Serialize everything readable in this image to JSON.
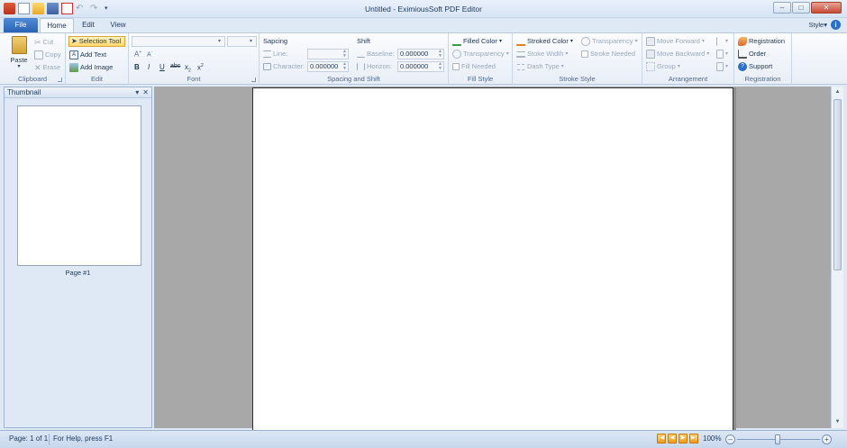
{
  "window": {
    "title": "Untitled - EximiousSoft PDF Editor"
  },
  "tabs": {
    "file": "File",
    "home": "Home",
    "edit": "Edit",
    "view": "View",
    "style_menu": "Style"
  },
  "ribbon": {
    "clipboard": {
      "label": "Clipboard",
      "paste": "Paste",
      "cut": "Cut",
      "copy": "Copy",
      "erase": "Erase"
    },
    "edit": {
      "label": "Edit",
      "selection_tool": "Selection Tool",
      "add_text": "Add Text",
      "add_image": "Add Image"
    },
    "font": {
      "label": "Font",
      "font_name": "",
      "font_size": ""
    },
    "spacing": {
      "label": "Spacing and Shift",
      "sapcing_title": "Sapcing",
      "line": "Line:",
      "character": "Character:",
      "character_value": "0.000000",
      "shift_title": "Shift",
      "baseline": "Baseline:",
      "baseline_value": "0.000000",
      "horizon": "Horizon:",
      "horizon_value": "0.000000"
    },
    "fill": {
      "label": "Fill Style",
      "filled_color": "Filled Color",
      "transparency": "Transparency",
      "fill_needed": "Fill Needed"
    },
    "stroke": {
      "label": "Stroke Style",
      "stroked_color": "Stroked Color",
      "stroke_width": "Stoke Width",
      "dash_type": "Dash Type",
      "transparency": "Transparency",
      "stroke_needed": "Stroke Needed"
    },
    "arrangement": {
      "label": "Arrangement",
      "move_forward": "Move Forward",
      "move_backward": "Move Backward",
      "group": "Group"
    },
    "registration": {
      "label": "Registration",
      "registration": "Registration",
      "order": "Order",
      "support": "Support"
    }
  },
  "thumbnail_panel": {
    "title": "Thumbnail",
    "page_label": "Page #1"
  },
  "status": {
    "page": "Page: 1 of 1",
    "help": "For Help, press F1",
    "zoom": "100%"
  },
  "colors": {
    "accent": "#2a62b5",
    "ribbon_bg": "#e8eef7",
    "workspace": "#a8a8a8",
    "highlight": "#ffd86b"
  }
}
